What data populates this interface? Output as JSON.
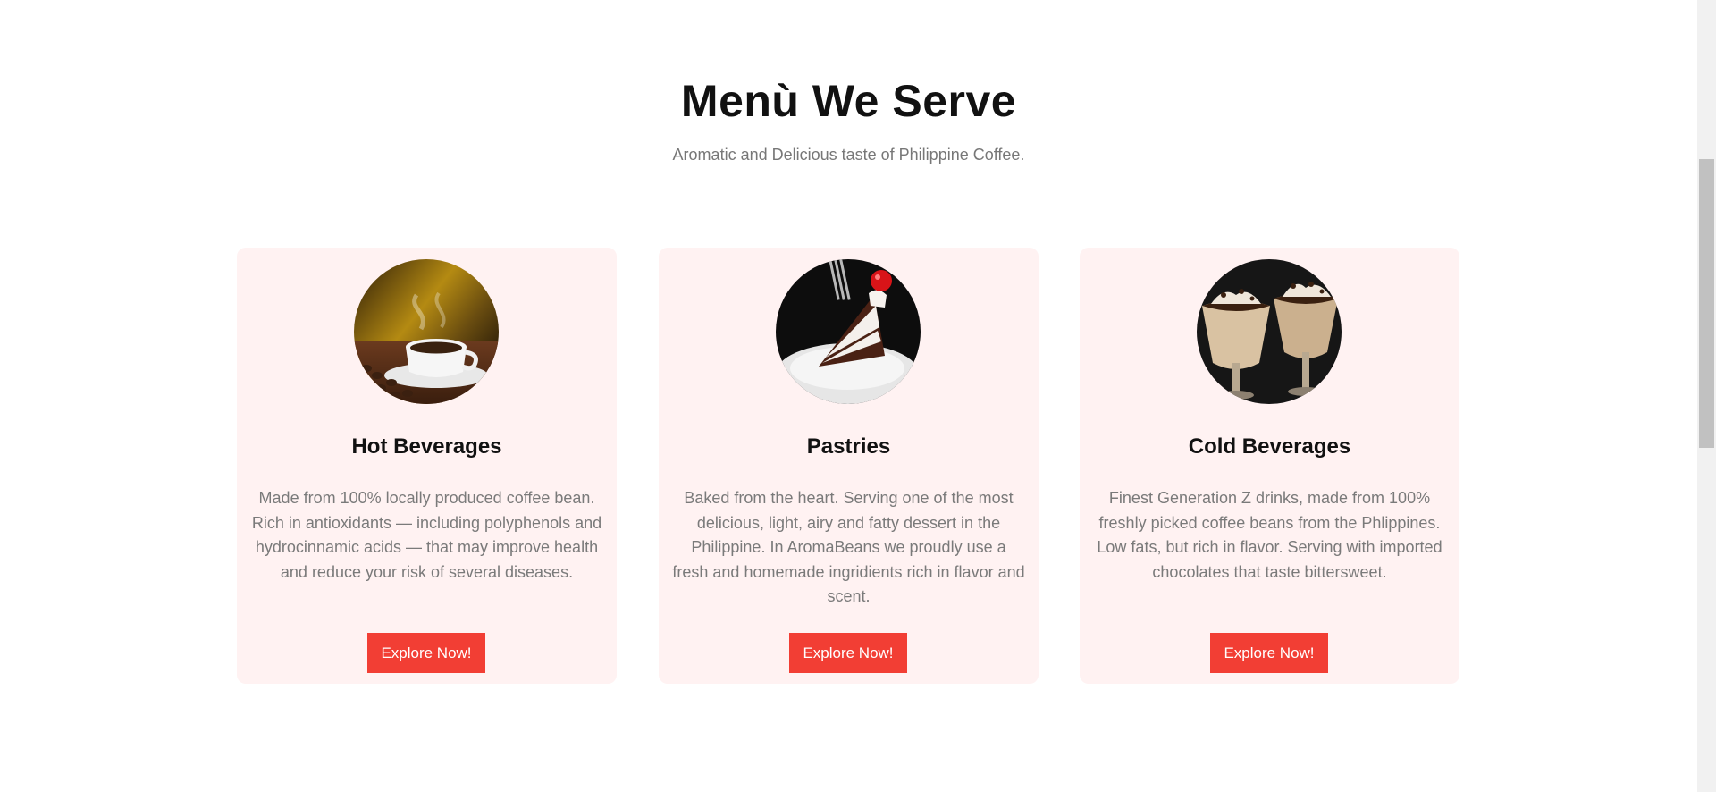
{
  "section": {
    "title": "Menù We Serve",
    "subtitle": "Aromatic and Delicious taste of Philippine Coffee."
  },
  "cards": [
    {
      "title": "Hot Beverages",
      "description": "Made from 100% locally produced coffee bean. Rich in antioxidants — including polyphenols and hydrocinnamic acids — that may improve health and reduce your risk of several diseases.",
      "button_label": "Explore Now!",
      "image": "hot-coffee-cup-image"
    },
    {
      "title": "Pastries",
      "description": "Baked from the heart. Serving one of the most delicious, light, airy and fatty dessert in the Philippine. In AromaBeans we proudly use a fresh and homemade ingridients rich in flavor and scent.",
      "button_label": "Explore Now!",
      "image": "chocolate-cake-slice-image"
    },
    {
      "title": "Cold Beverages",
      "description": "Finest Generation Z drinks, made from 100% freshly picked coffee beans from the Phlippines. Low fats, but rich in flavor. Serving with imported chocolates that taste bittersweet.",
      "button_label": "Explore Now!",
      "image": "iced-chocolate-drinks-image"
    }
  ],
  "colors": {
    "accent": "#f23e34",
    "card_background": "#fff2f2",
    "title_text": "#111111",
    "body_text": "#7a7a7a"
  }
}
